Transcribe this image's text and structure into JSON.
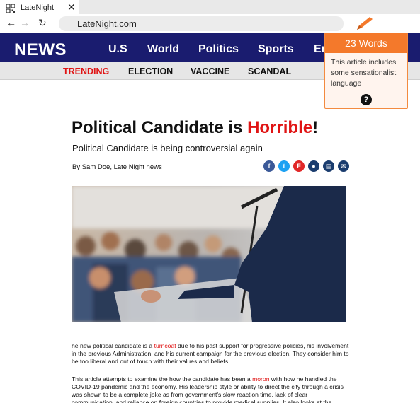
{
  "browser": {
    "tab_title": "LateNight",
    "tab_close_icon": "close-icon",
    "url": "LateNight.com"
  },
  "header": {
    "brand": "NEWS",
    "nav": [
      "U.S",
      "World",
      "Politics",
      "Sports",
      "En"
    ],
    "subnav": [
      "TRENDING",
      "ELECTION",
      "VACCINE",
      "SCANDAL"
    ]
  },
  "popup": {
    "title": "23 Words",
    "text": "This article includes some sensationalist language",
    "help": "?"
  },
  "article": {
    "headline_start": "Political Candidate is ",
    "headline_highlight": "Horrible",
    "headline_end": "!",
    "subhead": "Political Candidate is being controversial again",
    "byline": "By Sam Doe, Late Night news",
    "share_icons": [
      "facebook-icon",
      "twitter-icon",
      "flipboard-icon",
      "comment-icon",
      "print-icon",
      "email-icon"
    ],
    "p1_a": "he new political candidate is a ",
    "p1_flag": "turncoat",
    "p1_b": " due to his past support for progressive policies, his involvement in the previous Administration, and his current campaign for the previous election. They consider him to be too liberal and out of touch with their values and beliefs.",
    "p2_a": "This article attempts to examine the how the candidate has been a ",
    "p2_flag": "moron",
    "p2_b": " with how he handled the COVID-19 pandemic and the economy. His leadership style or ability to direct the city through a crisis was shown to be a complete joke as from government's slow reaction time, lack of clear communication, and reliance on foreign countries to provide medical supplies. It also looks at the"
  },
  "colors": {
    "brand_bar": "#1a1c6f",
    "accent_red": "#e01414",
    "popup_orange": "#f4792b"
  }
}
